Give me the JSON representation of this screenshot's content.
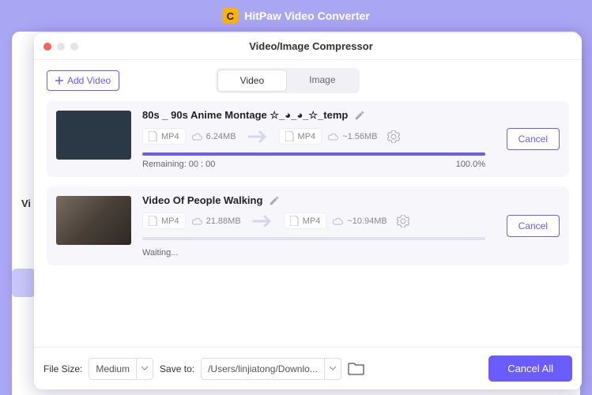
{
  "app": {
    "title": "HitPaw Video Converter"
  },
  "dialog": {
    "title": "Video/Image Compressor",
    "add_video": "Add Video",
    "tabs": {
      "video": "Video",
      "image": "Image",
      "active": "video"
    }
  },
  "items": [
    {
      "name": "80s _ 90s Anime Montage ☆_◕_◕_☆_temp",
      "src_format": "MP4",
      "src_size": "6.24MB",
      "dst_format": "MP4",
      "dst_size": "~1.56MB",
      "remaining_label": "Remaining:",
      "remaining_value": "00 : 00",
      "progress_pct": "100.0%",
      "progress_fill": 100,
      "cancel": "Cancel"
    },
    {
      "name": "Video Of People Walking",
      "src_format": "MP4",
      "src_size": "21.88MB",
      "dst_format": "MP4",
      "dst_size": "~10.94MB",
      "status": "Waiting...",
      "progress_fill": 0,
      "cancel": "Cancel"
    }
  ],
  "footer": {
    "filesize_label": "File Size:",
    "filesize_value": "Medium",
    "saveto_label": "Save to:",
    "saveto_value": "/Users/linjiatong/Downlo...",
    "cancel_all": "Cancel All"
  },
  "peek": {
    "left_text": "Vi"
  }
}
